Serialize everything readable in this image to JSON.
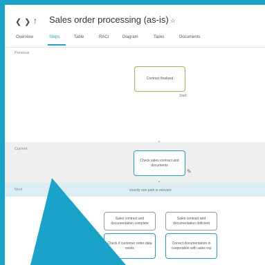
{
  "header": {
    "back_icon": "chevron-left-icon",
    "forward_icon": "chevron-right-icon",
    "up_icon": "arrow-up-icon",
    "title": "Sales order processing (as-is)",
    "favorite_icon": "star-icon",
    "tabs": [
      {
        "label": "Overview"
      },
      {
        "label": "Steps"
      },
      {
        "label": "Table"
      },
      {
        "label": "RACI"
      },
      {
        "label": "Diagram"
      },
      {
        "label": "Tasks"
      },
      {
        "label": "Documents"
      }
    ],
    "active_tab": "Steps"
  },
  "sections": {
    "previous": {
      "label": "Previous"
    },
    "current": {
      "label": "Current"
    },
    "next": {
      "label": "Next",
      "hint": "exactly one path is relevant"
    }
  },
  "steps": {
    "previous_step": {
      "label": "Contract finalized",
      "tag": "Start"
    },
    "current_step": {
      "label": "Check sales contract and documents"
    },
    "next_options": [
      {
        "label": "Sales contract and documentation complete"
      },
      {
        "label": "Sales contract and documentation deficient"
      }
    ],
    "next_steps": [
      {
        "label": "Check if customer order data exists"
      },
      {
        "label": "Correct documentation in cooperation with sales rep"
      }
    ]
  },
  "colors": {
    "accent": "#1aa3c8",
    "start_border": "#8ac440",
    "current_band": "#efefef",
    "next_band": "#dcedf4"
  }
}
